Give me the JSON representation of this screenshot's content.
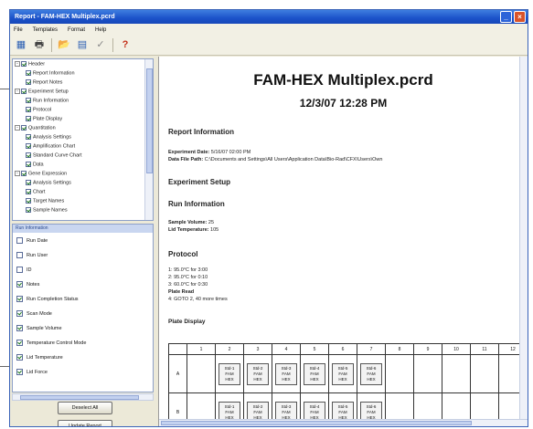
{
  "window": {
    "title": "Report - FAM-HEX Multiplex.pcrd",
    "minimize_label": "_",
    "close_label": "×"
  },
  "menu": [
    "File",
    "Templates",
    "Format",
    "Help"
  ],
  "toolbar": {
    "icons": [
      "save-icon",
      "print-icon",
      "open-folder-icon",
      "export-icon",
      "check-icon",
      "help-icon"
    ],
    "glyphs": [
      "▦",
      "🖶",
      "📂",
      "▤",
      "✓",
      "?"
    ]
  },
  "tree": {
    "items": [
      {
        "label": "Header",
        "expander": "-",
        "level": 0
      },
      {
        "label": "Report Information",
        "level": 1
      },
      {
        "label": "Report Notes",
        "level": 1
      },
      {
        "label": "Experiment Setup",
        "expander": "-",
        "level": 0
      },
      {
        "label": "Run Information",
        "level": 1
      },
      {
        "label": "Protocol",
        "level": 1
      },
      {
        "label": "Plate Display",
        "level": 1
      },
      {
        "label": "Quantitation",
        "expander": "-",
        "level": 0
      },
      {
        "label": "Analysis Settings",
        "level": 1
      },
      {
        "label": "Amplification Chart",
        "level": 1
      },
      {
        "label": "Standard Curve Chart",
        "level": 1
      },
      {
        "label": "Data",
        "level": 1
      },
      {
        "label": "Gene Expression",
        "expander": "-",
        "level": 0
      },
      {
        "label": "Analysis Settings",
        "level": 1
      },
      {
        "label": "Chart",
        "level": 1
      },
      {
        "label": "Target Names",
        "level": 1
      },
      {
        "label": "Sample Names",
        "level": 1
      }
    ]
  },
  "options": {
    "header": "Run Information",
    "items": [
      {
        "label": "Run Date",
        "checked": false
      },
      {
        "label": "Run User",
        "checked": false
      },
      {
        "label": "ID",
        "checked": false
      },
      {
        "label": "Notes",
        "checked": true
      },
      {
        "label": "Run Completion Status",
        "checked": true
      },
      {
        "label": "Scan Mode",
        "checked": true
      },
      {
        "label": "Sample Volume",
        "checked": true
      },
      {
        "label": "Temperature Control Mode",
        "checked": true
      },
      {
        "label": "Lid Temperature",
        "checked": true
      },
      {
        "label": "Lid Force",
        "checked": true
      }
    ]
  },
  "buttons": {
    "deselect_all": "Deselect All",
    "update_report": "Update Report"
  },
  "report": {
    "title": "FAM-HEX Multiplex.pcrd",
    "datetime": "12/3/07 12:28 PM",
    "report_info_heading": "Report Information",
    "experiment_date_label": "Experiment Date:",
    "experiment_date_value": "5/16/07 02:00 PM",
    "data_file_label": "Data File Path:",
    "data_file_value": "C:\\Documents and Settings\\All Users\\Application Data\\Bio-Rad\\CFX\\Users\\Own",
    "experiment_setup_heading": "Experiment Setup",
    "run_info_heading": "Run Information",
    "sample_volume_label": "Sample Volume:",
    "sample_volume_value": "25",
    "lid_temp_label": "Lid Temperature:",
    "lid_temp_value": "105",
    "protocol_heading": "Protocol",
    "protocol_steps": [
      "1: 95.0°C for 3:00",
      "2: 95.0°C for 0:10",
      "3: 60.0°C for 0:30",
      "Plate Read",
      "4: GOTO 2, 40 more times"
    ],
    "plate_display_heading": "Plate Display"
  },
  "plate": {
    "columns": [
      "1",
      "2",
      "3",
      "4",
      "5",
      "6",
      "7",
      "8",
      "9",
      "10",
      "11",
      "12"
    ],
    "rows": [
      {
        "label": "A",
        "wells": [
          {
            "col": 2,
            "lines": [
              "Std-1",
              "FAM",
              "HEX"
            ]
          },
          {
            "col": 3,
            "lines": [
              "Std-2",
              "FAM",
              "HEX"
            ]
          },
          {
            "col": 4,
            "lines": [
              "Std-3",
              "FAM",
              "HEX"
            ]
          },
          {
            "col": 5,
            "lines": [
              "Std-4",
              "FAM",
              "HEX"
            ]
          },
          {
            "col": 6,
            "lines": [
              "Std-5",
              "FAM",
              "HEX"
            ]
          },
          {
            "col": 7,
            "lines": [
              "Std-6",
              "FAM",
              "HEX"
            ]
          }
        ]
      },
      {
        "label": "B",
        "wells": [
          {
            "col": 2,
            "lines": [
              "Std-1",
              "FAM",
              "HEX"
            ]
          },
          {
            "col": 3,
            "lines": [
              "Std-2",
              "FAM",
              "HEX"
            ]
          },
          {
            "col": 4,
            "lines": [
              "Std-3",
              "FAM",
              "HEX"
            ]
          },
          {
            "col": 5,
            "lines": [
              "Std-4",
              "FAM",
              "HEX"
            ]
          },
          {
            "col": 6,
            "lines": [
              "Std-5",
              "FAM",
              "HEX"
            ]
          },
          {
            "col": 7,
            "lines": [
              "Std-6",
              "FAM",
              "HEX"
            ]
          }
        ]
      }
    ]
  },
  "colors": {
    "titlebar": "#1b52c9",
    "panel_bg": "#ece9d8",
    "selection_header": "#c9d6f0"
  }
}
